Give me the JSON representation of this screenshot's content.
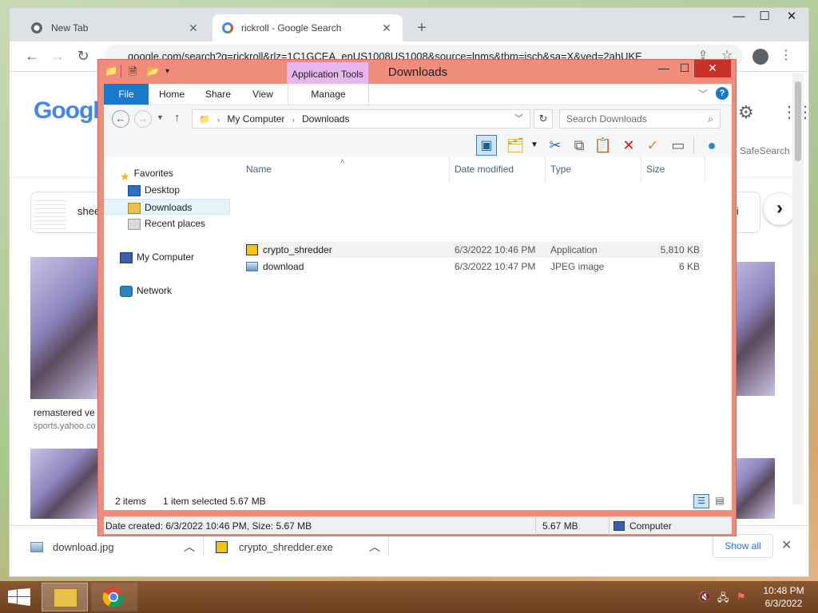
{
  "chrome": {
    "tabs": [
      {
        "title": "New Tab",
        "active": false
      },
      {
        "title": "rickroll - Google Search",
        "active": true
      }
    ],
    "url": "google.com/search?q=rickroll&rlz=1C1GCEA_enUS1008US1008&source=lnms&tbm=isch&sa=X&ved=2ahUKE",
    "page": {
      "logo": "Googl",
      "safesearch": "SafeSearch",
      "chip_left": "shee",
      "chip_right": "ii",
      "caption_title": "remastered ve",
      "caption_source": "sports.yahoo.co"
    },
    "downloads": [
      {
        "name": "download.jpg"
      },
      {
        "name": "crypto_shredder.exe"
      }
    ],
    "show_all": "Show all"
  },
  "explorer": {
    "title": "Downloads",
    "contextual_tab": "Application Tools",
    "ribbon_tabs": [
      "File",
      "Home",
      "Share",
      "View",
      "Manage"
    ],
    "address": {
      "root": "My Computer",
      "current": "Downloads"
    },
    "search_placeholder": "Search Downloads",
    "nav": {
      "favorites": "Favorites",
      "desktop": "Desktop",
      "downloads": "Downloads",
      "recent": "Recent places",
      "computer": "My Computer",
      "network": "Network"
    },
    "columns": [
      "Name",
      "Date modified",
      "Type",
      "Size"
    ],
    "files": [
      {
        "name": "crypto_shredder",
        "date": "6/3/2022 10:46 PM",
        "type": "Application",
        "size": "5,810 KB",
        "selected": true
      },
      {
        "name": "download",
        "date": "6/3/2022 10:47 PM",
        "type": "JPEG image",
        "size": "6 KB",
        "selected": false
      }
    ],
    "status": {
      "count": "2 items",
      "selection": "1 item selected",
      "selection_size": "5.67 MB"
    },
    "details": {
      "text": "Date created: 6/3/2022 10:46 PM, Size: 5.67 MB",
      "size": "5.67 MB",
      "location": "Computer"
    }
  },
  "taskbar": {
    "time": "10:48 PM",
    "date": "6/3/2022"
  },
  "colors": {
    "explorer_frame": "#f08c7c",
    "file_tab": "#1979ca",
    "contextual_tab": "#e7b6ef",
    "taskbar": "#7a4a25"
  }
}
